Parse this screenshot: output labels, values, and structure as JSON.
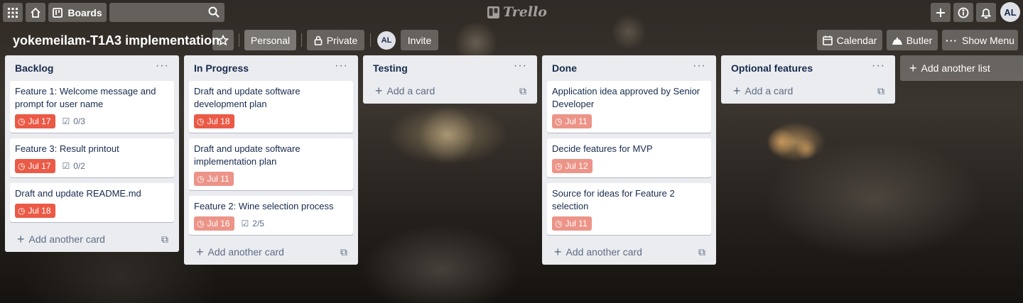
{
  "header": {
    "boards_label": "Boards",
    "logo_text": "Trello",
    "user_initials": "AL"
  },
  "board": {
    "title": "yokemeilam-T1A3 implementation",
    "workspace_label": "Personal",
    "visibility_label": "Private",
    "member_initials": "AL",
    "invite_label": "Invite",
    "calendar_label": "Calendar",
    "butler_label": "Butler",
    "show_menu_label": "Show Menu"
  },
  "lists": [
    {
      "title": "Backlog",
      "cards": [
        {
          "title": "Feature 1: Welcome message and prompt for user name",
          "due": "Jul 17",
          "due_status": "overdue",
          "checklist": "0/3"
        },
        {
          "title": "Feature 3: Result printout",
          "due": "Jul 17",
          "due_status": "overdue",
          "checklist": "0/2"
        },
        {
          "title": "Draft and update README.md",
          "due": "Jul 18",
          "due_status": "overdue",
          "checklist": ""
        }
      ],
      "add_label": "Add another card"
    },
    {
      "title": "In Progress",
      "cards": [
        {
          "title": "Draft and update software development plan",
          "due": "Jul 18",
          "due_status": "overdue",
          "checklist": ""
        },
        {
          "title": "Draft and update software implementation plan",
          "due": "Jul 11",
          "due_status": "past",
          "checklist": ""
        },
        {
          "title": "Feature 2: Wine selection process",
          "due": "Jul 16",
          "due_status": "past",
          "checklist": "2/5"
        }
      ],
      "add_label": "Add another card"
    },
    {
      "title": "Testing",
      "cards": [],
      "add_label": "Add a card"
    },
    {
      "title": "Done",
      "cards": [
        {
          "title": "Application idea approved by Senior Developer",
          "due": "Jul 11",
          "due_status": "past",
          "checklist": ""
        },
        {
          "title": "Decide features for MVP",
          "due": "Jul 12",
          "due_status": "past",
          "checklist": ""
        },
        {
          "title": "Source for ideas for Feature 2 selection",
          "due": "Jul 11",
          "due_status": "past",
          "checklist": ""
        }
      ],
      "add_label": "Add another card"
    },
    {
      "title": "Optional features",
      "cards": [],
      "add_label": "Add a card"
    }
  ],
  "add_list_label": "Add another list",
  "colors": {
    "due_overdue": "#eb5a46",
    "due_past": "#ec9488",
    "list_bg": "#ebecf0"
  }
}
